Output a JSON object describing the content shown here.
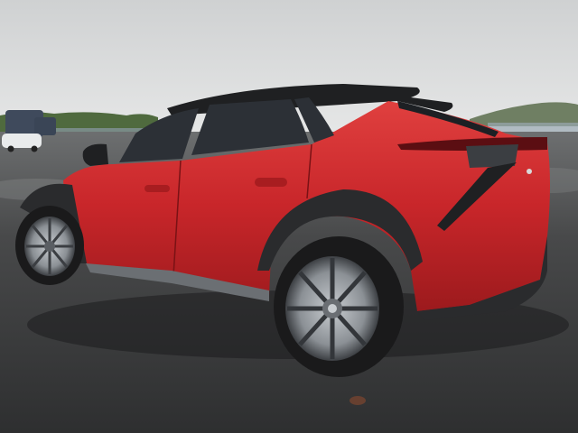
{
  "photo": {
    "subject": "suv-rear-three-quarter",
    "colors": {
      "sky": "#d9dbdc",
      "pavement": "#3a3b3c",
      "body_red": "#c8262a",
      "body_shadow": "#8e1518",
      "cladding": "#2a2b2d",
      "glass": "#2c3036",
      "rim": "#9ea3a8",
      "tree_line": "#4f6a3e",
      "hill": "#6f7f63"
    }
  }
}
